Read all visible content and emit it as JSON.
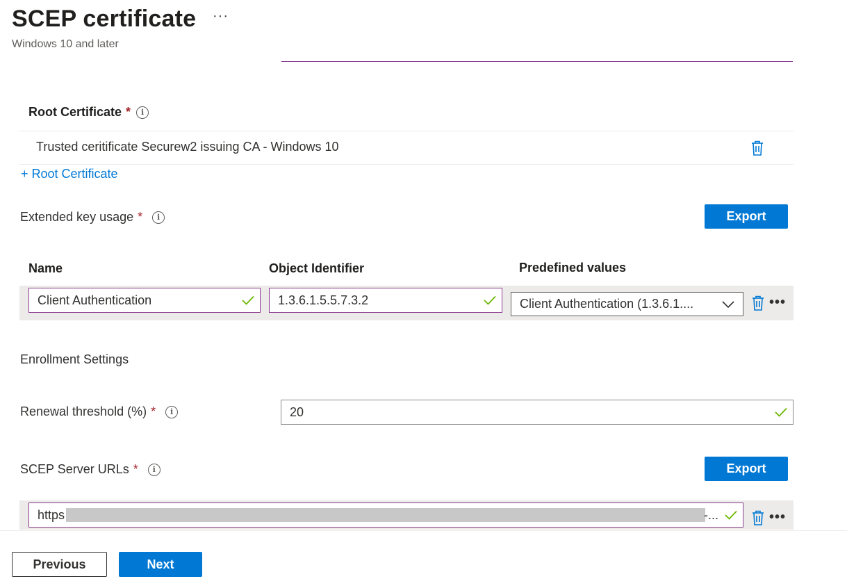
{
  "header": {
    "title": "SCEP certificate",
    "more": "···",
    "subtitle": "Windows 10 and later"
  },
  "root_certificate": {
    "label": "Root Certificate",
    "required_marker": "*",
    "info": "i",
    "value": "Trusted ceritificate Securew2 issuing CA - Windows 10",
    "add_link": "+ Root Certificate"
  },
  "eku": {
    "label": "Extended key usage",
    "required_marker": "*",
    "info": "i",
    "export_label": "Export",
    "columns": [
      "Name",
      "Object Identifier",
      "Predefined values"
    ],
    "row": {
      "name": "Client Authentication",
      "oid": "1.3.6.1.5.5.7.3.2",
      "predefined": "Client Authentication (1.3.6.1...."
    },
    "more": "•••"
  },
  "enrollment": {
    "heading": "Enrollment Settings",
    "renewal_label": "Renewal threshold (%)",
    "required_marker": "*",
    "info": "i",
    "renewal_value": "20"
  },
  "scep": {
    "label": "SCEP Server URLs",
    "required_marker": "*",
    "info": "i",
    "export_label": "Export",
    "url_prefix": "https",
    "url_suffix": "-...",
    "more": "•••"
  },
  "footer": {
    "previous_label": "Previous",
    "next_label": "Next"
  },
  "colors": {
    "accent": "#0078d4",
    "focus_border": "#8a3b8f",
    "valid_check": "#6bb700",
    "required": "#a4262c"
  },
  "icons": [
    "more-icon",
    "info-icon",
    "trash-icon",
    "checkmark-icon",
    "chevron-down-icon"
  ]
}
